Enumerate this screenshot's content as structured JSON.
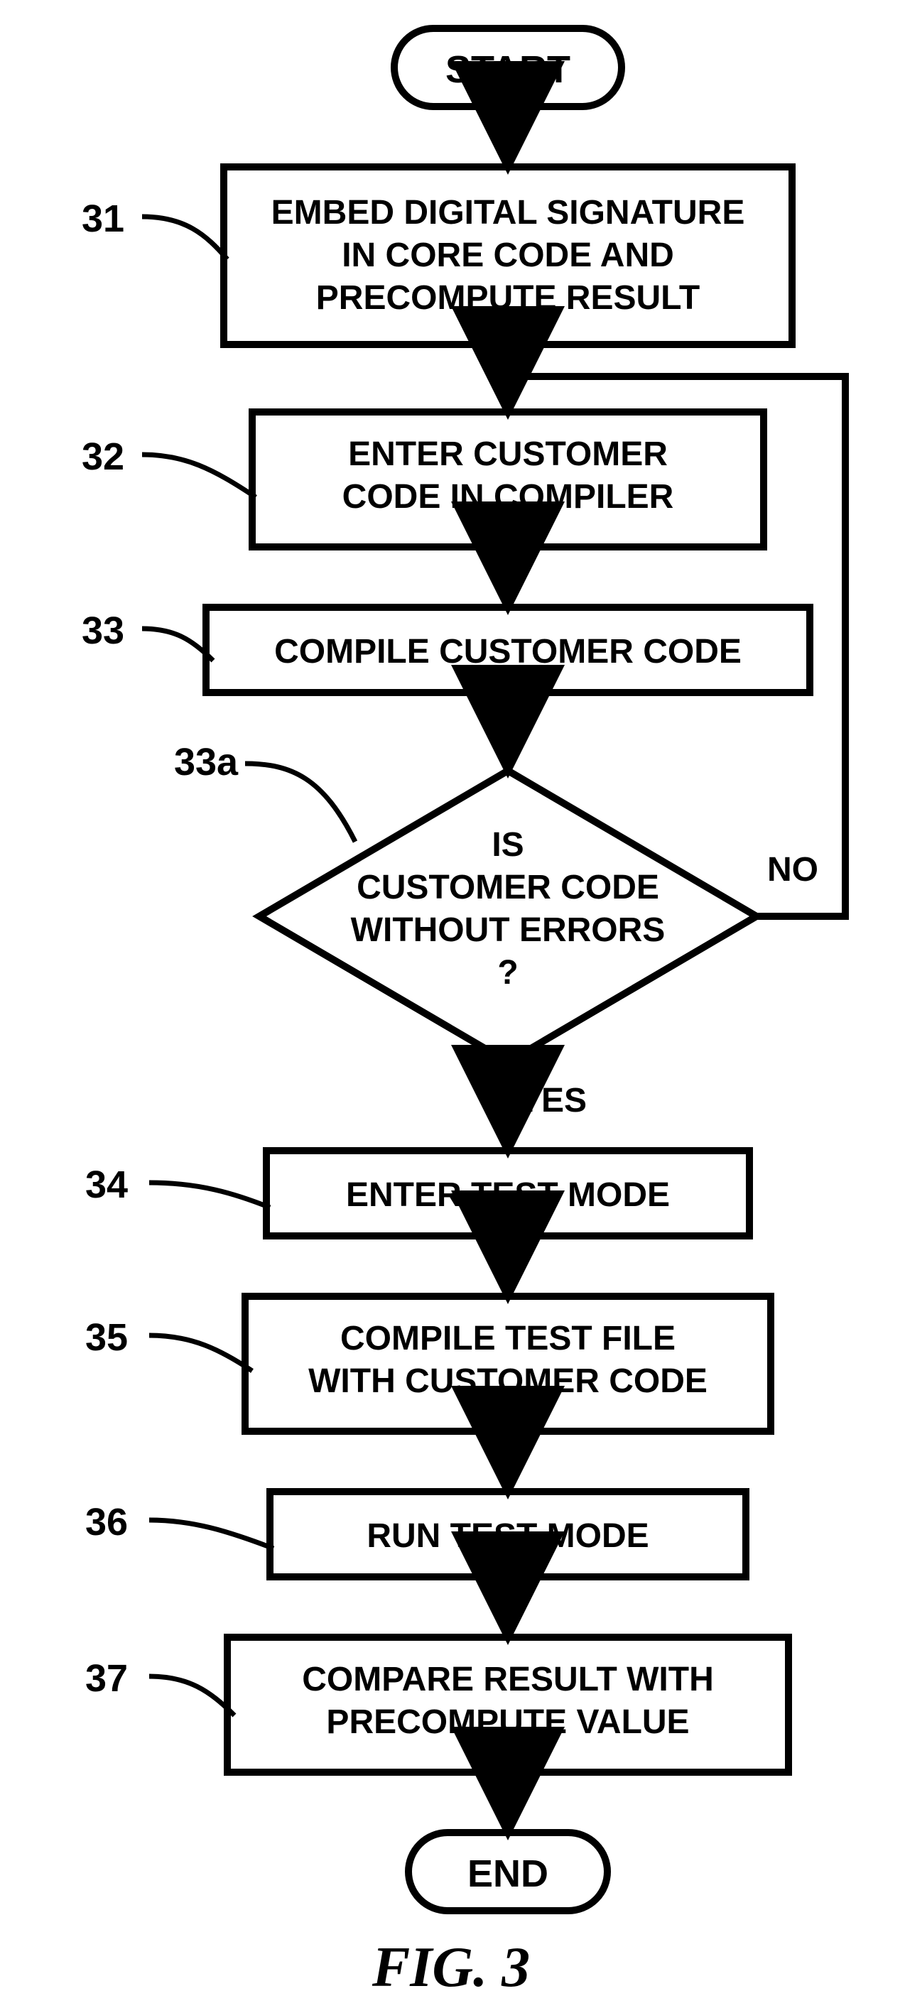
{
  "terminals": {
    "start": "START",
    "end": "END"
  },
  "boxes": {
    "b31": {
      "ref": "31",
      "text": "EMBED DIGITAL SIGNATURE\nIN CORE CODE AND\nPRECOMPUTE RESULT"
    },
    "b32": {
      "ref": "32",
      "text": "ENTER CUSTOMER\nCODE IN COMPILER"
    },
    "b33": {
      "ref": "33",
      "text": "COMPILE CUSTOMER CODE"
    },
    "b34": {
      "ref": "34",
      "text": "ENTER TEST MODE"
    },
    "b35": {
      "ref": "35",
      "text": "COMPILE TEST FILE\nWITH CUSTOMER CODE"
    },
    "b36": {
      "ref": "36",
      "text": "RUN TEST MODE"
    },
    "b37": {
      "ref": "37",
      "text": "COMPARE RESULT WITH\nPRECOMPUTE VALUE"
    }
  },
  "decision": {
    "ref": "33a",
    "text": "IS\nCUSTOMER CODE\nWITHOUT ERRORS\n?"
  },
  "edges": {
    "yes": "YES",
    "no": "NO"
  },
  "figure_label": "FIG.  3"
}
